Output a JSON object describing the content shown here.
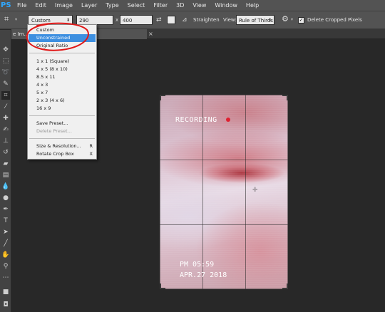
{
  "app": {
    "logo": "PS"
  },
  "menubar": {
    "items": [
      "File",
      "Edit",
      "Image",
      "Layer",
      "Type",
      "Select",
      "Filter",
      "3D",
      "View",
      "Window",
      "Help"
    ]
  },
  "options": {
    "ratio_value": "Custom",
    "width_value": "290",
    "x_sep": "x",
    "height_value": "400",
    "straighten_label": "Straighten",
    "view_label": "View:",
    "view_value": "Rule of Thirds",
    "delete_label": "Delete Cropped Pixels",
    "delete_checked": "✓"
  },
  "document": {
    "tab_label": "e Im...................view, RGB/8) *",
    "tab_close": "×"
  },
  "canvas": {
    "recording_label": "RECORDING",
    "time_label": "PM 05:59",
    "date_label": "APR.27 2018"
  },
  "dropdown": {
    "group1": [
      "Custom",
      "Unconstrained",
      "Original Ratio"
    ],
    "selected": "Unconstrained",
    "group2": [
      "1 x 1 (Square)",
      "4 x 5 (8 x 10)",
      "8.5 x 11",
      "4 x 3",
      "5 x 7",
      "2 x 3 (4 x 6)",
      "16 x 9"
    ],
    "group3": [
      {
        "label": "Save Preset...",
        "disabled": false
      },
      {
        "label": "Delete Preset...",
        "disabled": true
      }
    ],
    "group4": [
      {
        "label": "Size & Resolution...",
        "shortcut": "R"
      },
      {
        "label": "Rotate Crop Box",
        "shortcut": "X"
      }
    ]
  },
  "colors": {
    "annotation": "#e01818",
    "selection": "#3d8fe0",
    "recording_dot": "#e02030",
    "ps_blue": "#31a8ff"
  },
  "icons": [
    "crop-icon",
    "swap-icon",
    "clear-icon",
    "straighten-icon",
    "gear-icon",
    "checkbox-icon"
  ]
}
